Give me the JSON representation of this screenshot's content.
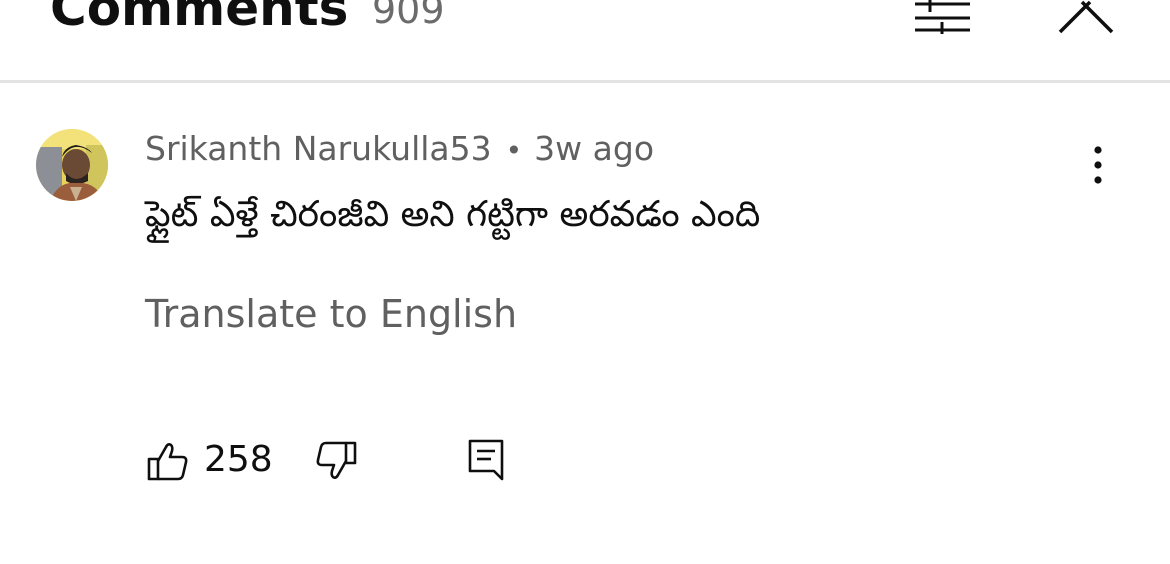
{
  "header": {
    "title": "Comments",
    "count": "909",
    "filter_icon": "filter-sliders-icon",
    "close_icon": "close-icon"
  },
  "comment": {
    "author": "Srikanth Narukulla53",
    "separator": "•",
    "time": "3w ago",
    "text": "ఫ్లైట్ ఏళ్తే చిరంజీవి అని గట్టిగా అరవడం ఎంది",
    "translate_label": "Translate to English",
    "like_count": "258",
    "avatar_icon": "avatar",
    "more_icon": "more-vert-icon",
    "like_icon": "thumb-up-icon",
    "dislike_icon": "thumb-down-icon",
    "reply_icon": "reply-comment-icon"
  },
  "colors": {
    "text_primary": "#0f0f0f",
    "text_secondary": "#606060",
    "divider": "#e3e3e3"
  }
}
